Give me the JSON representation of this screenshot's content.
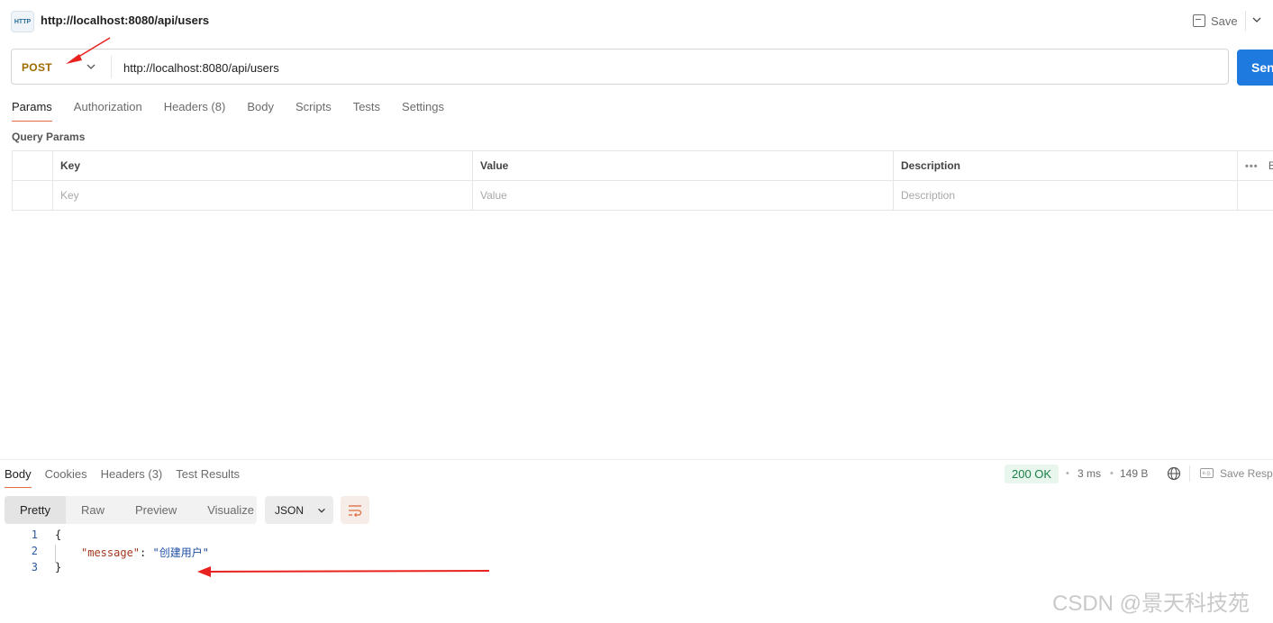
{
  "request": {
    "title": "http://localhost:8080/api/users",
    "icon_text": "HTTP",
    "method": "POST",
    "url": "http://localhost:8080/api/users",
    "save_label": "Save",
    "send_label": "Send"
  },
  "request_tabs": [
    {
      "label": "Params",
      "active": true
    },
    {
      "label": "Authorization"
    },
    {
      "label": "Headers (8)"
    },
    {
      "label": "Body"
    },
    {
      "label": "Scripts"
    },
    {
      "label": "Tests"
    },
    {
      "label": "Settings"
    }
  ],
  "query_params": {
    "label": "Query Params",
    "columns": [
      "Key",
      "Value",
      "Description"
    ],
    "placeholders": {
      "key": "Key",
      "value": "Value",
      "description": "Description"
    },
    "ops_label": "•••",
    "bulk_edit_label": "B"
  },
  "response": {
    "tabs": [
      {
        "label": "Body",
        "active": true
      },
      {
        "label": "Cookies"
      },
      {
        "label": "Headers (3)"
      },
      {
        "label": "Test Results"
      }
    ],
    "status": "200 OK",
    "time": "3 ms",
    "size": "149 B",
    "save_label": "Save Response",
    "save_icon_text": "e.g.",
    "views": [
      {
        "label": "Pretty",
        "active": true
      },
      {
        "label": "Raw"
      },
      {
        "label": "Preview"
      },
      {
        "label": "Visualize"
      }
    ],
    "format": "JSON",
    "code_lines": [
      {
        "n": "1",
        "text": "{"
      },
      {
        "n": "2",
        "key": "\"message\"",
        "colon": ": ",
        "value": "\"创建用户\""
      },
      {
        "n": "3",
        "text": "}"
      }
    ]
  },
  "watermark": "CSDN @景天科技苑",
  "colors": {
    "accent_tab": "#e06b3f",
    "send": "#1f7ae0",
    "method": "#9e6b00",
    "status_ok": "#1a7f45",
    "annotation_arrow": "#e8231f"
  }
}
